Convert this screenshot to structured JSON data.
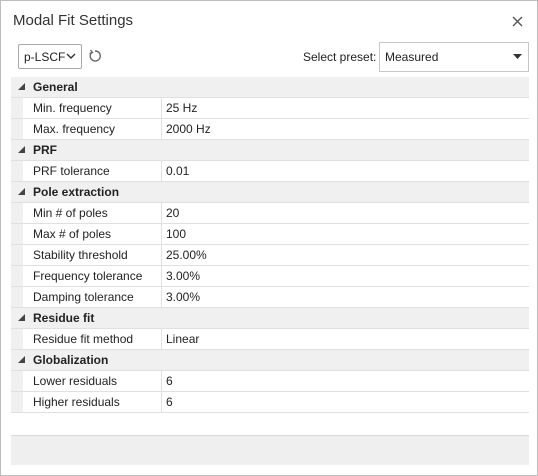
{
  "window": {
    "title": "Modal Fit Settings"
  },
  "toolbar": {
    "method_value": "p-LSCF",
    "preset_label": "Select preset:",
    "preset_value": "Measured"
  },
  "categories": [
    {
      "label": "General",
      "rows": [
        {
          "name": "Min. frequency",
          "value": "25 Hz"
        },
        {
          "name": "Max. frequency",
          "value": "2000 Hz"
        }
      ]
    },
    {
      "label": "PRF",
      "rows": [
        {
          "name": "PRF tolerance",
          "value": "0.01"
        }
      ]
    },
    {
      "label": "Pole extraction",
      "rows": [
        {
          "name": "Min # of poles",
          "value": "20"
        },
        {
          "name": "Max # of poles",
          "value": "100"
        },
        {
          "name": "Stability threshold",
          "value": "25.00%"
        },
        {
          "name": "Frequency tolerance",
          "value": "3.00%"
        },
        {
          "name": "Damping tolerance",
          "value": "3.00%"
        }
      ]
    },
    {
      "label": "Residue fit",
      "rows": [
        {
          "name": "Residue fit method",
          "value": "Linear"
        }
      ]
    },
    {
      "label": "Globalization",
      "rows": [
        {
          "name": "Lower residuals",
          "value": "6"
        },
        {
          "name": "Higher residuals",
          "value": "6"
        }
      ]
    }
  ],
  "icons": {
    "close": "close-icon",
    "reset": "refresh-icon",
    "dropdown": "chevron-down-icon",
    "collapse": "collapse-triangle-icon"
  }
}
